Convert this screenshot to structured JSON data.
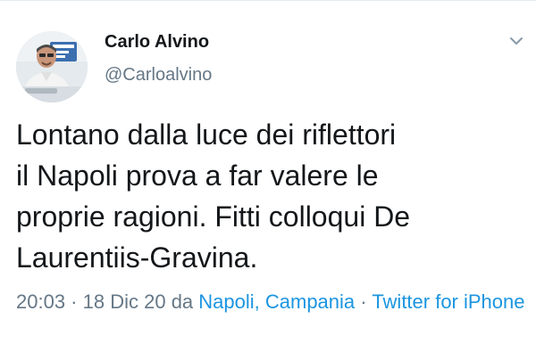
{
  "author": {
    "display_name": "Carlo Alvino",
    "handle": "@Carloalvino"
  },
  "icons": {
    "menu": "chevron-down-icon",
    "avatar": "profile-photo"
  },
  "tweet": {
    "lines": [
      "Lontano dalla luce dei riflettori",
      "il Napoli prova a far valere le",
      "proprie ragioni. Fitti colloqui De",
      "Laurentiis-Gravina."
    ]
  },
  "meta": {
    "time": "20:03",
    "separator_1": " · ",
    "date": "18 Dic 20",
    "from_word": " da ",
    "location": "Napoli, Campania",
    "separator_2": " · ",
    "source": "Twitter for iPhone"
  },
  "colors": {
    "text": "#14171a",
    "secondary": "#657786",
    "link": "#1b95e0"
  }
}
